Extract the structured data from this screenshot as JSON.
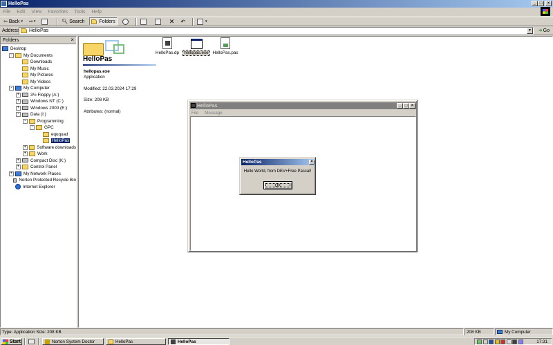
{
  "window": {
    "title": "HelloPas",
    "buttons": {
      "minimize": "_",
      "maximize": "□",
      "close": "×"
    }
  },
  "menu": [
    "File",
    "Edit",
    "View",
    "Favorites",
    "Tools",
    "Help"
  ],
  "toolbar": {
    "back": "Back",
    "search": "Search",
    "folders": "Folders"
  },
  "address": {
    "label": "Address",
    "value": "HelloPas",
    "go": "Go"
  },
  "folders_pane": {
    "title": "Folders",
    "close": "×",
    "items": [
      {
        "label": "Desktop",
        "depth": 0,
        "expander": "",
        "icon": "desktop-icon"
      },
      {
        "label": "My Documents",
        "depth": 1,
        "expander": "-",
        "icon": "folder-icon"
      },
      {
        "label": "Downloads",
        "depth": 2,
        "expander": "",
        "icon": "folder-icon"
      },
      {
        "label": "My Music",
        "depth": 2,
        "expander": "",
        "icon": "folder-icon"
      },
      {
        "label": "My Pictures",
        "depth": 2,
        "expander": "",
        "icon": "folder-icon"
      },
      {
        "label": "My Videos",
        "depth": 2,
        "expander": "",
        "icon": "folder-icon"
      },
      {
        "label": "My Computer",
        "depth": 1,
        "expander": "-",
        "icon": "computer-icon"
      },
      {
        "label": "3½ Floppy (A:)",
        "depth": 2,
        "expander": "+",
        "icon": "drive-icon"
      },
      {
        "label": "Windows NT (C:)",
        "depth": 2,
        "expander": "+",
        "icon": "drive-icon"
      },
      {
        "label": "Windows 2000 (E:)",
        "depth": 2,
        "expander": "+",
        "icon": "drive-icon"
      },
      {
        "label": "Data (I:)",
        "depth": 2,
        "expander": "-",
        "icon": "drive-icon"
      },
      {
        "label": "Programming",
        "depth": 3,
        "expander": "-",
        "icon": "folder-icon"
      },
      {
        "label": "GPC",
        "depth": 4,
        "expander": "-",
        "icon": "folder-icon"
      },
      {
        "label": "eququad",
        "depth": 5,
        "expander": "",
        "icon": "folder-icon"
      },
      {
        "label": "HelloPas",
        "depth": 5,
        "expander": "",
        "icon": "folder-open-icon",
        "selected": true
      },
      {
        "label": "Software downloads",
        "depth": 3,
        "expander": "+",
        "icon": "folder-icon"
      },
      {
        "label": "Work",
        "depth": 3,
        "expander": "+",
        "icon": "folder-icon"
      },
      {
        "label": "Compact Disc (K:)",
        "depth": 2,
        "expander": "+",
        "icon": "cd-drive-icon"
      },
      {
        "label": "Control Panel",
        "depth": 2,
        "expander": "+",
        "icon": "control-panel-icon"
      },
      {
        "label": "My Network Places",
        "depth": 1,
        "expander": "+",
        "icon": "network-icon"
      },
      {
        "label": "Norton Protected Recycle Bin",
        "depth": 1,
        "expander": "",
        "icon": "recycle-bin-icon"
      },
      {
        "label": "Internet Explorer",
        "depth": 1,
        "expander": "",
        "icon": "ie-icon"
      }
    ]
  },
  "content": {
    "folder_title": "HelloPas",
    "selected_file": {
      "name": "hellopas.exe",
      "type": "Application",
      "modified": "Modified: 22.03.2024 17:29",
      "size": "Size: 208 KB",
      "attributes": "Attributes: (normal)"
    },
    "files": [
      {
        "name": "HelloPas.dp",
        "icon": "dev-project-icon"
      },
      {
        "name": "hellopas.exe",
        "icon": "exe-icon",
        "selected": true
      },
      {
        "name": "HelloPas.pas",
        "icon": "pascal-source-icon"
      }
    ]
  },
  "app_window": {
    "title": "HelloPas",
    "menu": [
      "File",
      "Message"
    ],
    "buttons": {
      "minimize": "_",
      "maximize": "□",
      "close": "×"
    }
  },
  "dialog": {
    "title": "HelloPas",
    "message": "Hello World, from DEV+Free Pascal!",
    "ok": "OK",
    "close": "×"
  },
  "statusbar": {
    "left": "Type: Application Size: 208 KB",
    "size": "208 KB",
    "zone": "My Computer"
  },
  "taskbar": {
    "start": "Start",
    "tasks": [
      {
        "label": "Norton System Doctor",
        "active": false
      },
      {
        "label": "HelloPas",
        "active": false
      },
      {
        "label": "HelloPas",
        "active": true
      }
    ],
    "clock": "17:31"
  },
  "colors": {
    "title_active": "#0a246a",
    "title_gradient_end": "#a6caf0",
    "title_inactive": "#808080",
    "face": "#d4d0c8"
  }
}
